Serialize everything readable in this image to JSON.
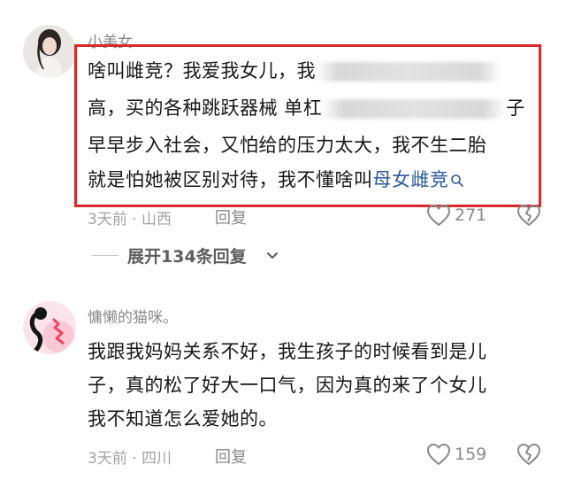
{
  "comments": [
    {
      "username": "小美女",
      "lines": [
        "啥叫雌竞？我爱我女儿，我",
        "高，买的各种跳跃器械 单杠",
        "子",
        "早早步入社会，又怕给的压力太大，我不生二胎",
        "就是怕她被区别对待，我不懂啥叫"
      ],
      "link_text": "母女雌竞",
      "meta": "3天前 · 山西",
      "reply_label": "回复",
      "like_count": "271",
      "expand_label": "展开134条回复"
    },
    {
      "username": "慵懒的猫咪。",
      "lines": [
        "我跟我妈妈关系不好，我生孩子的时候看到是儿",
        "子，真的松了好大一口气，因为真的来了个女儿",
        "我不知道怎么爱她的。"
      ],
      "meta": "3天前 · 四川",
      "reply_label": "回复",
      "like_count": "159"
    }
  ],
  "colors": {
    "highlight_border": "#d9282a",
    "link": "#2b5a9c",
    "meta_text": "#a3a3a3"
  },
  "icons": [
    "search-icon",
    "heart-icon",
    "broken-heart-icon",
    "chevron-down-icon"
  ]
}
